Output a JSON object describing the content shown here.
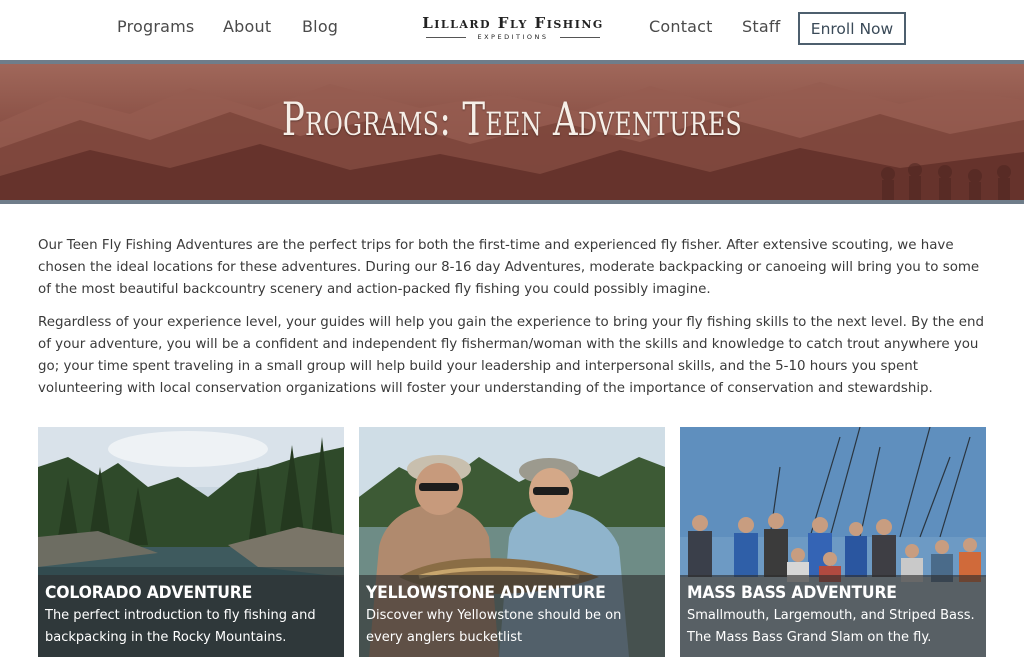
{
  "header": {
    "nav_left": [
      "Programs",
      "About",
      "Blog"
    ],
    "logo_main": "Lillard Fly Fishing",
    "logo_sub": "EXPEDITIONS",
    "nav_right": [
      "Contact",
      "Staff"
    ],
    "enroll_label": "Enroll Now"
  },
  "hero": {
    "title": "Programs: Teen Adventures"
  },
  "intro": {
    "paragraphs": [
      "Our Teen Fly Fishing Adventures are the perfect trips for both the first-time and experienced fly fisher. After extensive scouting, we have chosen the ideal locations for these adventures. During our 8-16 day Adventures, moderate backpacking or canoeing will bring you to some of the most beautiful backcountry scenery and action-packed fly fishing you could possibly imagine.",
      "Regardless of your experience level, your guides will help you gain the experience to bring your fly fishing skills to the next level. By the end of your adventure, you will be a confident and independent fly fisherman/woman with the skills and knowledge to catch trout anywhere you go; your time spent traveling in a small group will help build your leadership and interpersonal skills, and the 5-10 hours you spent volunteering with local conservation organizations will foster your understanding of the importance of conservation and stewardship."
    ]
  },
  "cards": [
    {
      "title": "COLORADO ADVENTURE",
      "description": "The perfect introduction to fly fishing and backpacking in the Rocky Mountains."
    },
    {
      "title": "YELLOWSTONE ADVENTURE",
      "description": "Discover why Yellowstone should be on every anglers bucketlist"
    },
    {
      "title": "MASS BASS ADVENTURE",
      "description": "Smallmouth, Largemouth, and Striped Bass. The Mass Bass Grand Slam on the fly."
    }
  ],
  "colors": {
    "hero_bg": "#8a5146",
    "rule": "#6f7d8a",
    "button_border": "#4d5f6e",
    "caption_overlay": "rgba(45,45,45,0.62)"
  }
}
